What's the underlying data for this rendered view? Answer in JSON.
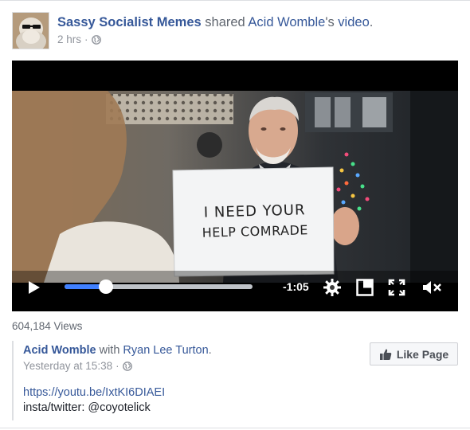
{
  "post": {
    "page_name": "Sassy Socialist Memes",
    "shared_text": " shared ",
    "original_author": "Acid Womble",
    "possessive": "'s ",
    "object": "video",
    "period": ".",
    "time": "2 hrs",
    "separator": " · ",
    "privacy_icon": "globe-icon"
  },
  "video": {
    "sign_line1": "I NEED YOUR",
    "sign_line2": "HELP COMRADE",
    "time_remaining": "-1:05",
    "progress": 0.22,
    "icons": [
      "play-icon",
      "settings-icon",
      "pip-icon",
      "fullscreen-icon",
      "mute-icon"
    ]
  },
  "views": "604,184 Views",
  "attribution": {
    "author": "Acid Womble",
    "with_text": " with ",
    "tagged": "Ryan Lee Turton",
    "period": ".",
    "time": "Yesterday at 15:38",
    "separator": " · ",
    "url": "https://youtu.be/IxtKI6DIAEI",
    "handle_line": "insta/twitter: @coyotelick"
  },
  "like_button": {
    "label": "Like Page",
    "icon": "thumbs-up-icon"
  },
  "colors": {
    "link": "#365899",
    "progress": "#4080ff",
    "muted": "#90949c"
  }
}
